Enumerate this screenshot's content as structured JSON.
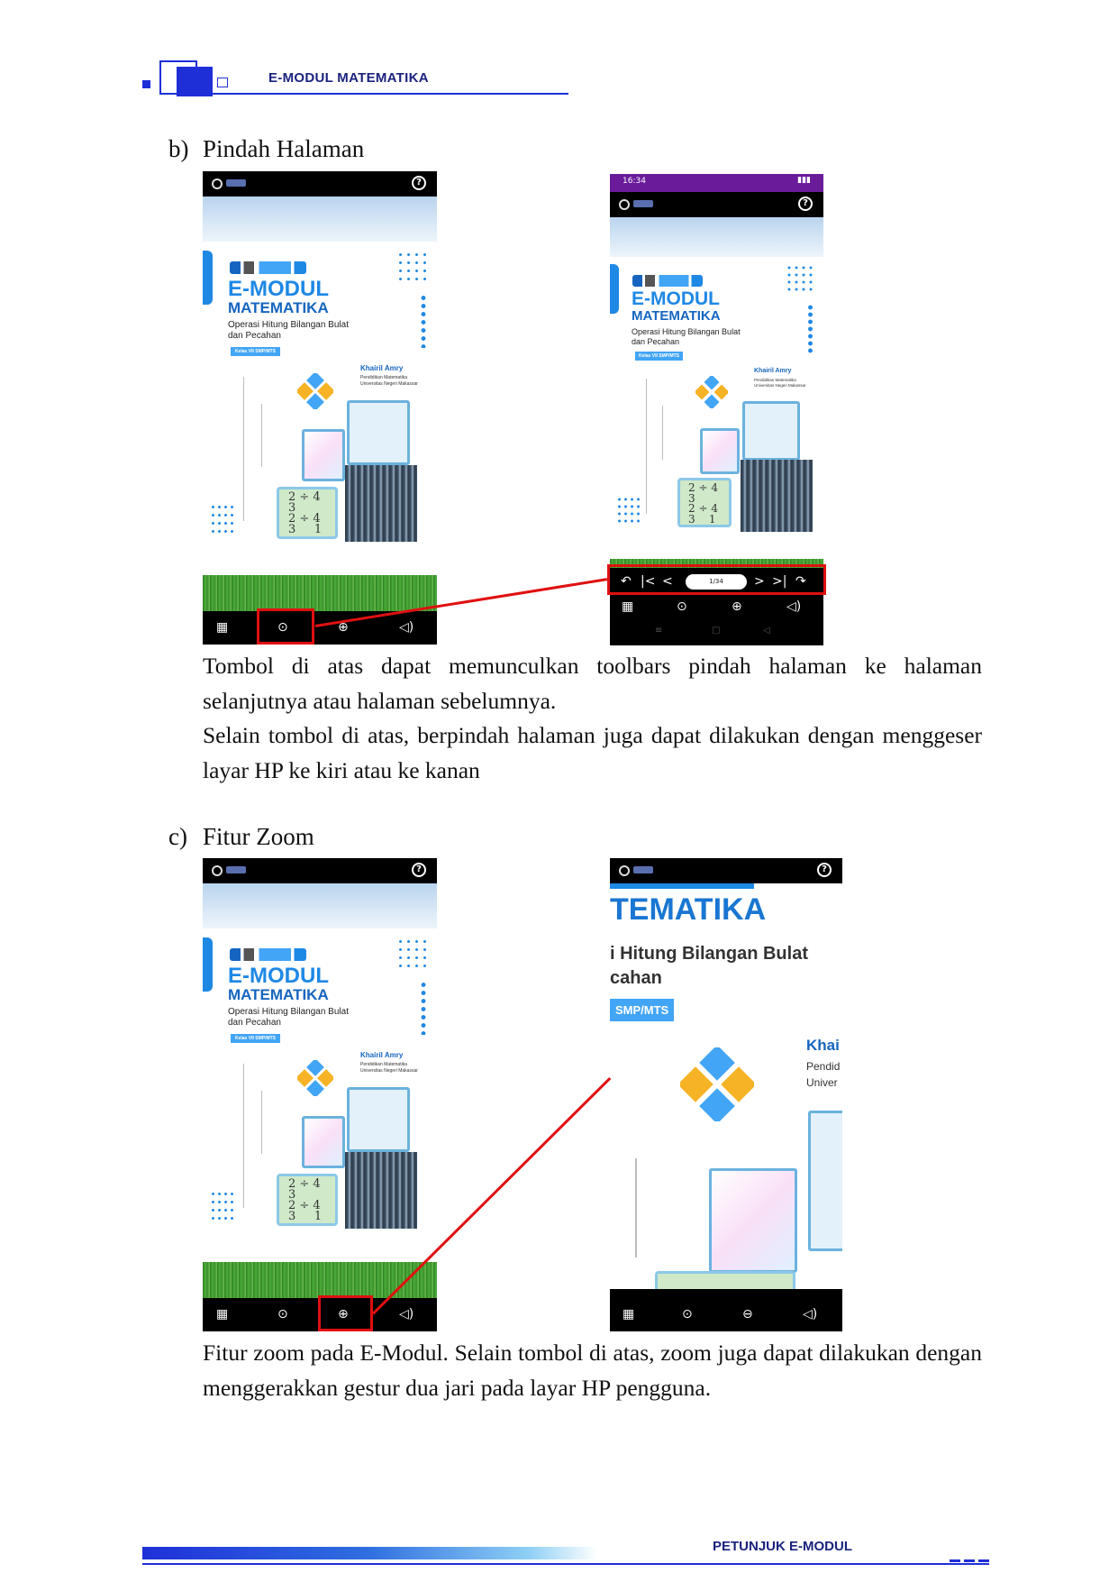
{
  "header": {
    "title": "E-MODUL MATEMATIKA"
  },
  "footer": {
    "title": "PETUNJUK E-MODUL"
  },
  "section_b": {
    "heading_marker": "b)",
    "heading": "Pindah Halaman",
    "paragraph1": "Tombol di atas dapat memunculkan toolbars pindah halaman ke halaman selanjutnya atau halaman sebelumnya.",
    "paragraph2": "Selain tombol di atas, berpindah halaman juga dapat dilakukan dengan menggeser layar HP ke kiri atau ke kanan"
  },
  "section_c": {
    "heading_marker": "c)",
    "heading": "Fitur Zoom",
    "paragraph1": "Fitur zoom pada E-Modul. Selain tombol di atas, zoom juga dapat dilakukan dengan menggerakkan gestur dua jari pada layar HP pengguna."
  },
  "cover": {
    "title_line1": "E-MODUL",
    "title_line2": "MATEMATIKA",
    "subtitle_line1": "Operasi Hitung Bilangan Bulat",
    "subtitle_line2": "dan Pecahan",
    "badge": "Kelas VII SMP/MTS",
    "author": "Khairil Amry",
    "author_dept": "Pendidikan Matematika",
    "author_univ": "Universitas Negeri Makassar"
  },
  "phone_status": {
    "time": "16:34"
  },
  "page_indicator": "1/34",
  "zoomed_cover": {
    "title_frag": "TEMATIKA",
    "subtitle_frag1": "i Hitung Bilangan Bulat",
    "subtitle_frag2": "cahan",
    "badge_frag": "SMP/MTS",
    "author_frag": "Khai",
    "dept_frag": "Pendid",
    "univ_frag": "Univer"
  },
  "icons": {
    "grid": "grid-icon",
    "page_nav": "page-navigation-icon",
    "zoom_in": "zoom-in-icon",
    "zoom_out": "zoom-out-icon",
    "sound": "sound-icon",
    "help": "help-icon"
  },
  "colors": {
    "accent_blue": "#1f2fd8",
    "highlight_red": "#e01010",
    "cover_blue": "#1e88e5"
  }
}
